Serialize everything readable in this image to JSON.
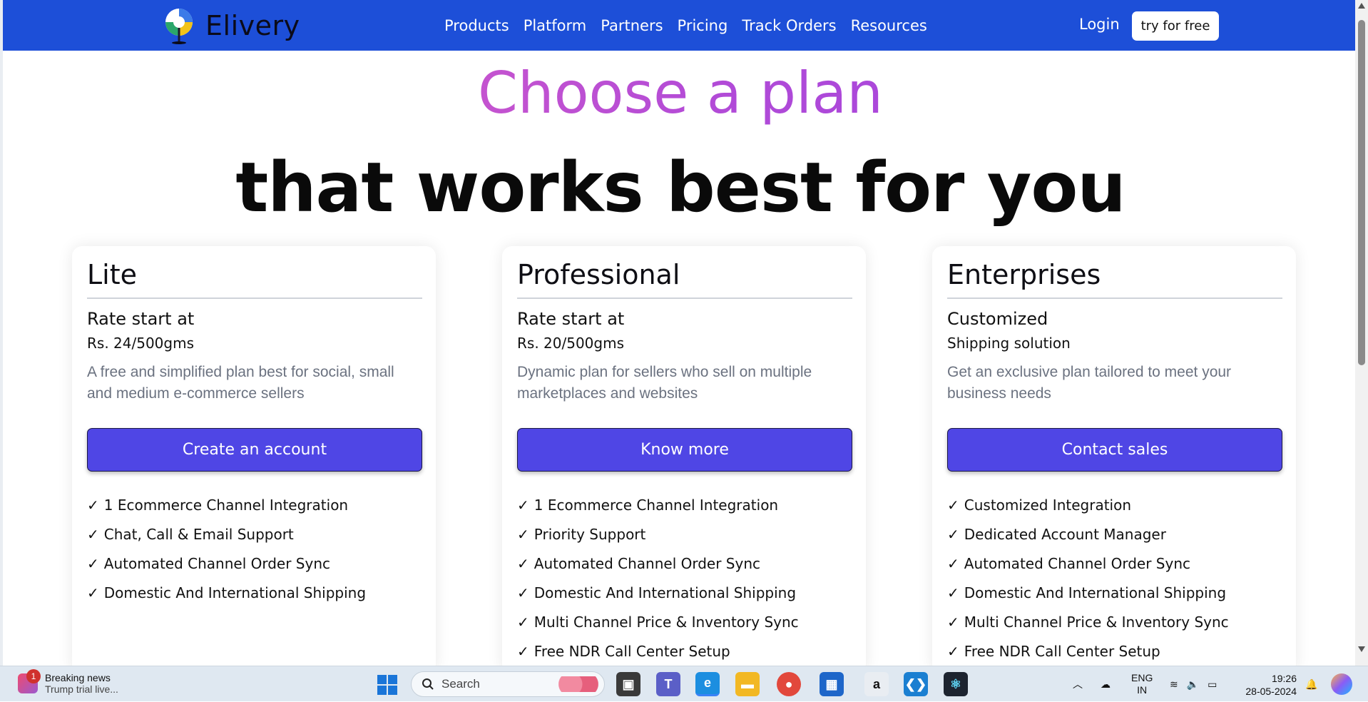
{
  "nav": {
    "brand": "Elivery",
    "links": [
      "Products",
      "Platform",
      "Partners",
      "Pricing",
      "Track Orders",
      "Resources"
    ],
    "login": "Login",
    "try_label": "try for free"
  },
  "hero": {
    "headline": "Choose a plan",
    "subheadline": "that works best for you"
  },
  "plans": [
    {
      "title": "Lite",
      "rate_label": "Rate start at",
      "price": "Rs. 24/500gms",
      "description": "A free and simplified plan best for social, small and medium e-commerce sellers",
      "cta": "Create an account",
      "features": [
        "1 Ecommerce Channel Integration",
        "Chat, Call & Email Support",
        "Automated Channel Order Sync",
        "Domestic And International Shipping"
      ]
    },
    {
      "title": "Professional",
      "rate_label": "Rate start at",
      "price": "Rs. 20/500gms",
      "description": "Dynamic plan for sellers who sell on multiple marketplaces and websites",
      "cta": "Know more",
      "features": [
        "1 Ecommerce Channel Integration",
        "Priority Support",
        "Automated Channel Order Sync",
        "Domestic And International Shipping",
        "Multi Channel Price & Inventory Sync",
        "Free NDR Call Center Setup"
      ]
    },
    {
      "title": "Enterprises",
      "rate_label": "Customized",
      "price": "Shipping solution",
      "description": "Get an exclusive plan tailored to meet your business needs",
      "cta": "Contact sales",
      "features": [
        "Customized Integration",
        "Dedicated Account Manager",
        "Automated Channel Order Sync",
        "Domestic And International Shipping",
        "Multi Channel Price & Inventory Sync",
        "Free NDR Call Center Setup"
      ]
    }
  ],
  "check_glyph": "✓",
  "taskbar": {
    "news_title": "Breaking news",
    "news_sub": "Trump trial live...",
    "news_badge": "1",
    "search_placeholder": "Search",
    "lang_line1": "ENG",
    "lang_line2": "IN",
    "time": "19:26",
    "date": "28-05-2024"
  },
  "colors": {
    "nav_bg": "#1d4fd8",
    "cta_bg": "#4f46e5",
    "headline_gradient_start": "#e864c0",
    "headline_gradient_end": "#9b3fe0"
  }
}
